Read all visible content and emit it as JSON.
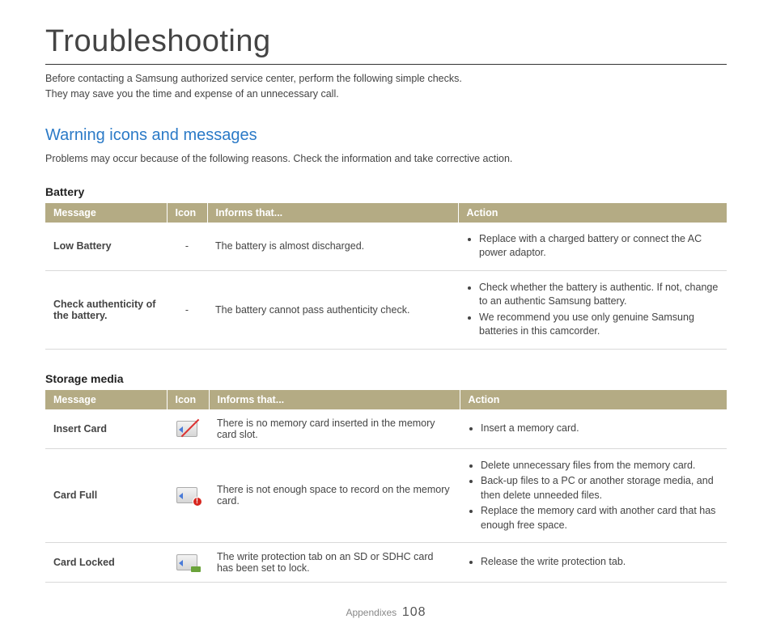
{
  "page": {
    "title": "Troubleshooting",
    "intro1": "Before contacting a Samsung authorized service center, perform the following simple checks.",
    "intro2": "They may save you the time and expense of an unnecessary call."
  },
  "section": {
    "heading": "Warning icons and messages",
    "intro": "Problems may occur because of the following reasons. Check the information and take corrective action."
  },
  "table_headers": {
    "message": "Message",
    "icon": "Icon",
    "informs": "Informs that...",
    "action": "Action"
  },
  "battery": {
    "heading": "Battery",
    "rows": [
      {
        "message": "Low Battery",
        "icon": "-",
        "informs": "The battery is almost discharged.",
        "actions": [
          "Replace with a charged battery or connect the AC power adaptor."
        ]
      },
      {
        "message": "Check authenticity of the battery.",
        "icon": "-",
        "informs": "The battery cannot pass authenticity check.",
        "actions": [
          "Check whether the battery is authentic. If not, change to an authentic Samsung battery.",
          "We recommend you use only genuine Samsung batteries in this camcorder."
        ]
      }
    ]
  },
  "storage": {
    "heading": "Storage media",
    "rows": [
      {
        "message": "Insert Card",
        "icon_type": "insert",
        "informs": "There is no memory card inserted in the memory card slot.",
        "actions": [
          "Insert a memory card."
        ]
      },
      {
        "message": "Card Full",
        "icon_type": "full",
        "informs": "There is not enough space to record on the memory card.",
        "actions": [
          "Delete unnecessary files from the memory card.",
          "Back-up files to a PC or another storage media, and then delete unneeded files.",
          "Replace the memory card with another card that has enough free space."
        ]
      },
      {
        "message": "Card Locked",
        "icon_type": "locked",
        "informs": "The write protection tab on an SD or SDHC card has been set to lock.",
        "actions": [
          "Release the write protection tab."
        ]
      }
    ]
  },
  "footer": {
    "label": "Appendixes",
    "page_number": "108"
  }
}
